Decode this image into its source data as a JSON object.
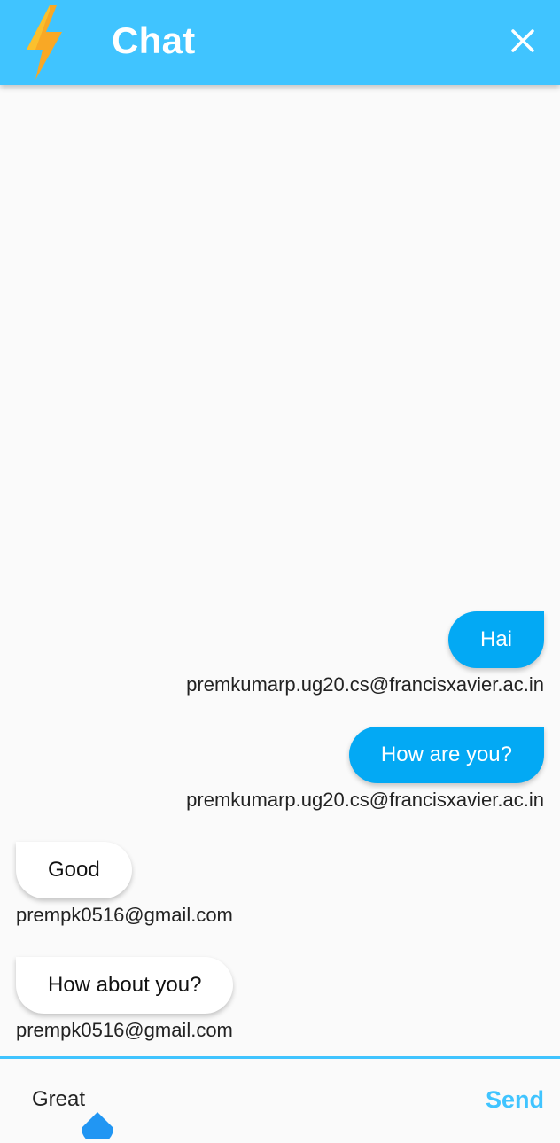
{
  "app_bar": {
    "title": "Chat",
    "logo_icon": "lightning-bolt-icon",
    "close_icon": "close-icon",
    "background_color": "#40c4ff"
  },
  "messages": [
    {
      "text": "Hai",
      "sender": "premkumarp.ug20.cs@francisxavier.ac.in",
      "is_me": true
    },
    {
      "text": "How are you?",
      "sender": "premkumarp.ug20.cs@francisxavier.ac.in",
      "is_me": true
    },
    {
      "text": "Good",
      "sender": "prempk0516@gmail.com",
      "is_me": false
    },
    {
      "text": "How about you?",
      "sender": "prempk0516@gmail.com",
      "is_me": false
    }
  ],
  "composer": {
    "input_value": "Great",
    "send_label": "Send"
  },
  "colors": {
    "accent": "#40c4ff",
    "my_bubble": "#03a9f4",
    "other_bubble": "#ffffff"
  }
}
